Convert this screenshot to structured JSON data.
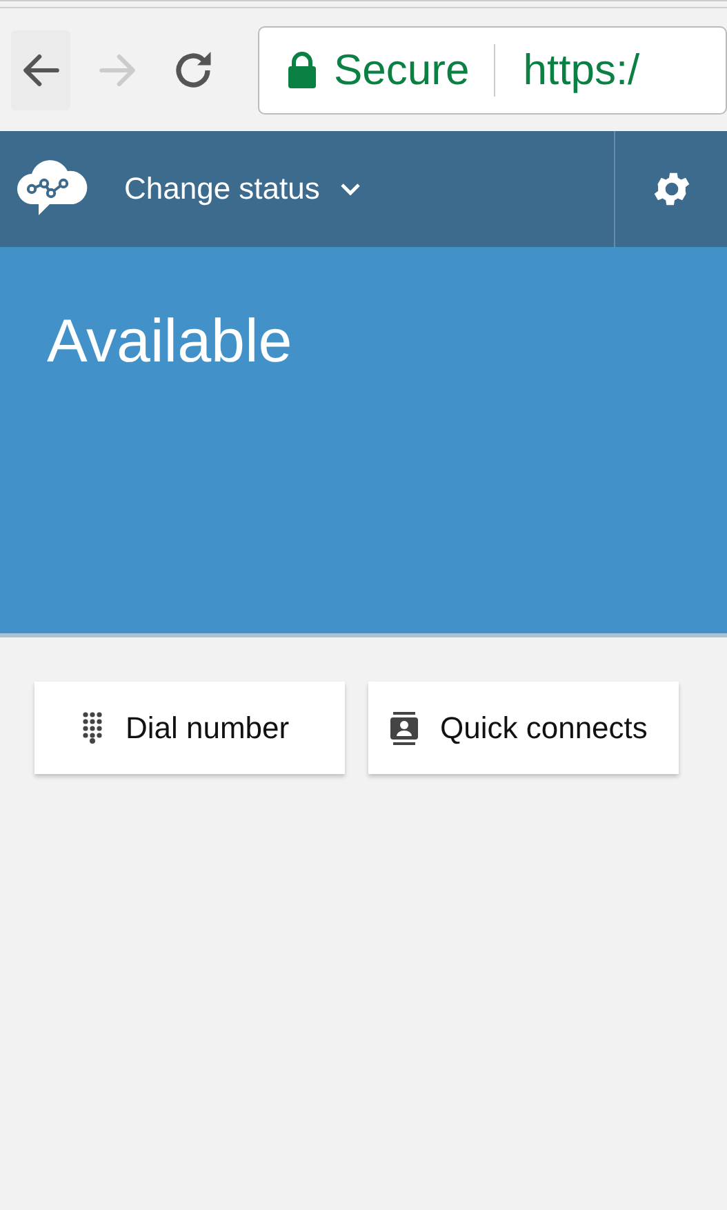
{
  "browser": {
    "back_disabled": false,
    "forward_disabled": true,
    "secure_label": "Secure",
    "url": "https:/"
  },
  "header": {
    "status_menu": "Change status"
  },
  "status": {
    "label": "Available"
  },
  "actions": [
    {
      "kind": "dialpad",
      "label": "Dial number"
    },
    {
      "kind": "contacts",
      "label": "Quick connects"
    }
  ]
}
